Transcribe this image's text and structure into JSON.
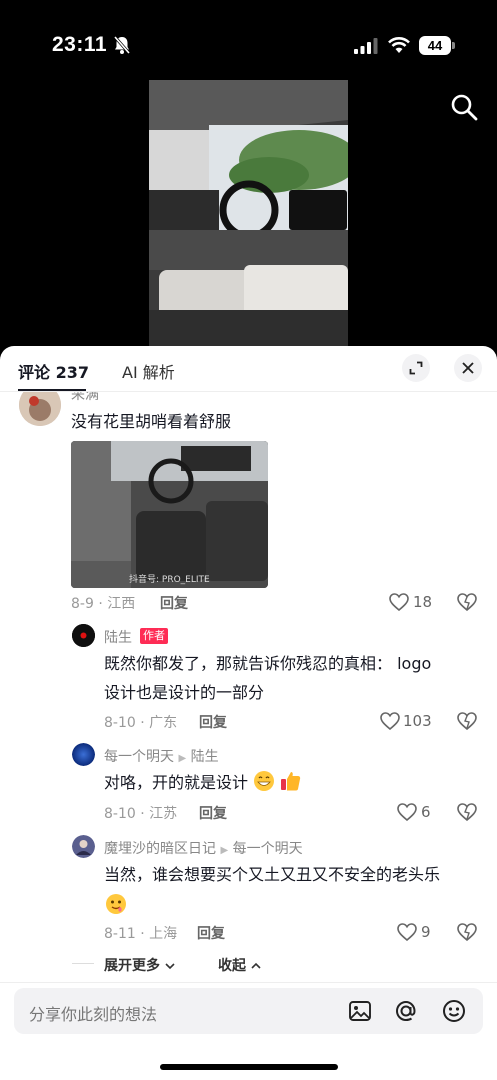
{
  "status_bar": {
    "time": "23:11",
    "battery": "44"
  },
  "tabs": {
    "comments": "评论 237",
    "ai": "AI 解析"
  },
  "comments": [
    {
      "name": "采满",
      "text": "没有花里胡哨看着舒服",
      "image_watermark": "抖音号: PRO_ELITE",
      "date_location": "8-9 · 江西",
      "reply": "回复",
      "likes": "18"
    },
    {
      "name": "陆生",
      "badge": "作者",
      "text_line1": "既然你都发了，那就告诉你残忍的真相： logo",
      "text_line2": "设计也是设计的一部分",
      "date_location": "8-10 · 广东",
      "reply": "回复",
      "likes": "103"
    },
    {
      "name": "每一个明天",
      "reply_to": "陆生",
      "text": "对咯，开的就是设计",
      "date_location": "8-10 · 江苏",
      "reply": "回复",
      "likes": "6"
    },
    {
      "name": "魔埋沙的暗区日记",
      "reply_to": "每一个明天",
      "text": "当然，谁会想要买个又土又丑又不安全的老头乐",
      "date_location": "8-11 · 上海",
      "reply": "回复",
      "likes": "9"
    }
  ],
  "expand_more": "展开更多",
  "collapse": "收起",
  "input": {
    "placeholder": "分享你此刻的想法"
  },
  "colors": {
    "accent": "#fe2c55",
    "text": "#161823",
    "muted": "#999999"
  }
}
